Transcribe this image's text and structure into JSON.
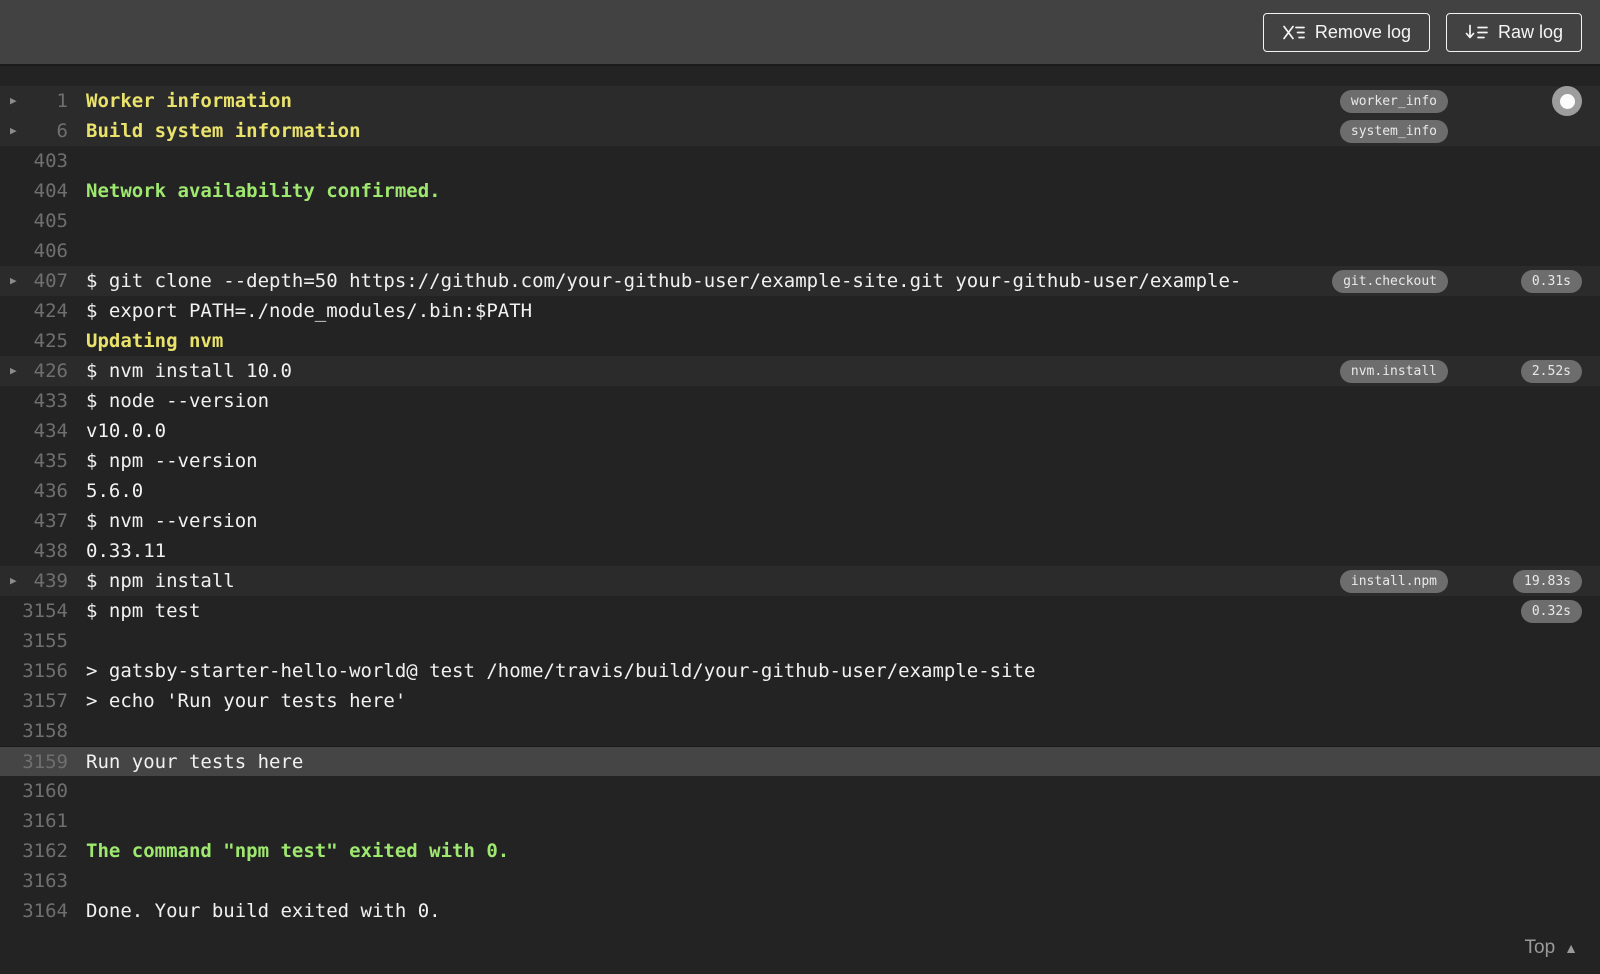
{
  "toolbar": {
    "remove_log_label": "Remove log",
    "raw_log_label": "Raw log"
  },
  "footer": {
    "top_label": "Top"
  },
  "colors": {
    "toolbar_bg": "#424242",
    "log_bg": "#232323",
    "fold_row_bg": "#2b2b2b",
    "highlight_row_bg": "#454545",
    "text": "#f1f1f1",
    "line_number": "#6f6f6f",
    "yellow_text": "#e9e26b",
    "green_text": "#9fe86f",
    "pill_bg": "#6d6d6d",
    "pill_text": "#e9e9e9"
  },
  "log": {
    "rows": [
      {
        "num": "1",
        "text": "Worker information",
        "style": "yellow",
        "fold": true,
        "tag": "worker_info",
        "duration": null,
        "band": true,
        "highlight": false,
        "knob": true
      },
      {
        "num": "6",
        "text": "Build system information",
        "style": "yellow",
        "fold": true,
        "tag": "system_info",
        "duration": null,
        "band": true,
        "highlight": false,
        "knob": false
      },
      {
        "num": "403",
        "text": "",
        "style": "default",
        "fold": false,
        "tag": null,
        "duration": null,
        "band": false,
        "highlight": false,
        "knob": false
      },
      {
        "num": "404",
        "text": "Network availability confirmed.",
        "style": "green",
        "fold": false,
        "tag": null,
        "duration": null,
        "band": false,
        "highlight": false,
        "knob": false
      },
      {
        "num": "405",
        "text": "",
        "style": "default",
        "fold": false,
        "tag": null,
        "duration": null,
        "band": false,
        "highlight": false,
        "knob": false
      },
      {
        "num": "406",
        "text": "",
        "style": "default",
        "fold": false,
        "tag": null,
        "duration": null,
        "band": false,
        "highlight": false,
        "knob": false
      },
      {
        "num": "407",
        "text": "$ git clone --depth=50 https://github.com/your-github-user/example-site.git your-github-user/example-",
        "style": "default",
        "fold": true,
        "tag": "git.checkout",
        "duration": "0.31s",
        "band": true,
        "highlight": false,
        "knob": false
      },
      {
        "num": "424",
        "text": "$ export PATH=./node_modules/.bin:$PATH",
        "style": "default",
        "fold": false,
        "tag": null,
        "duration": null,
        "band": false,
        "highlight": false,
        "knob": false
      },
      {
        "num": "425",
        "text": "Updating nvm",
        "style": "yellow",
        "fold": false,
        "tag": null,
        "duration": null,
        "band": false,
        "highlight": false,
        "knob": false
      },
      {
        "num": "426",
        "text": "$ nvm install 10.0",
        "style": "default",
        "fold": true,
        "tag": "nvm.install",
        "duration": "2.52s",
        "band": true,
        "highlight": false,
        "knob": false
      },
      {
        "num": "433",
        "text": "$ node --version",
        "style": "default",
        "fold": false,
        "tag": null,
        "duration": null,
        "band": false,
        "highlight": false,
        "knob": false
      },
      {
        "num": "434",
        "text": "v10.0.0",
        "style": "default",
        "fold": false,
        "tag": null,
        "duration": null,
        "band": false,
        "highlight": false,
        "knob": false
      },
      {
        "num": "435",
        "text": "$ npm --version",
        "style": "default",
        "fold": false,
        "tag": null,
        "duration": null,
        "band": false,
        "highlight": false,
        "knob": false
      },
      {
        "num": "436",
        "text": "5.6.0",
        "style": "default",
        "fold": false,
        "tag": null,
        "duration": null,
        "band": false,
        "highlight": false,
        "knob": false
      },
      {
        "num": "437",
        "text": "$ nvm --version",
        "style": "default",
        "fold": false,
        "tag": null,
        "duration": null,
        "band": false,
        "highlight": false,
        "knob": false
      },
      {
        "num": "438",
        "text": "0.33.11",
        "style": "default",
        "fold": false,
        "tag": null,
        "duration": null,
        "band": false,
        "highlight": false,
        "knob": false
      },
      {
        "num": "439",
        "text": "$ npm install",
        "style": "default",
        "fold": true,
        "tag": "install.npm",
        "duration": "19.83s",
        "band": true,
        "highlight": false,
        "knob": false
      },
      {
        "num": "3154",
        "text": "$ npm test",
        "style": "default",
        "fold": false,
        "tag": null,
        "duration": "0.32s",
        "band": false,
        "highlight": false,
        "knob": false
      },
      {
        "num": "3155",
        "text": "",
        "style": "default",
        "fold": false,
        "tag": null,
        "duration": null,
        "band": false,
        "highlight": false,
        "knob": false
      },
      {
        "num": "3156",
        "text": "> gatsby-starter-hello-world@ test /home/travis/build/your-github-user/example-site",
        "style": "default",
        "fold": false,
        "tag": null,
        "duration": null,
        "band": false,
        "highlight": false,
        "knob": false
      },
      {
        "num": "3157",
        "text": "> echo 'Run your tests here'",
        "style": "default",
        "fold": false,
        "tag": null,
        "duration": null,
        "band": false,
        "highlight": false,
        "knob": false
      },
      {
        "num": "3158",
        "text": "",
        "style": "default",
        "fold": false,
        "tag": null,
        "duration": null,
        "band": false,
        "highlight": false,
        "knob": false
      },
      {
        "num": "3159",
        "text": "Run your tests here",
        "style": "default",
        "fold": false,
        "tag": null,
        "duration": null,
        "band": false,
        "highlight": true,
        "knob": false
      },
      {
        "num": "3160",
        "text": "",
        "style": "default",
        "fold": false,
        "tag": null,
        "duration": null,
        "band": false,
        "highlight": false,
        "knob": false
      },
      {
        "num": "3161",
        "text": "",
        "style": "default",
        "fold": false,
        "tag": null,
        "duration": null,
        "band": false,
        "highlight": false,
        "knob": false
      },
      {
        "num": "3162",
        "text": "The command \"npm test\" exited with 0.",
        "style": "green",
        "fold": false,
        "tag": null,
        "duration": null,
        "band": false,
        "highlight": false,
        "knob": false
      },
      {
        "num": "3163",
        "text": "",
        "style": "default",
        "fold": false,
        "tag": null,
        "duration": null,
        "band": false,
        "highlight": false,
        "knob": false
      },
      {
        "num": "3164",
        "text": "Done. Your build exited with 0.",
        "style": "default",
        "fold": false,
        "tag": null,
        "duration": null,
        "band": false,
        "highlight": false,
        "knob": false
      }
    ]
  }
}
